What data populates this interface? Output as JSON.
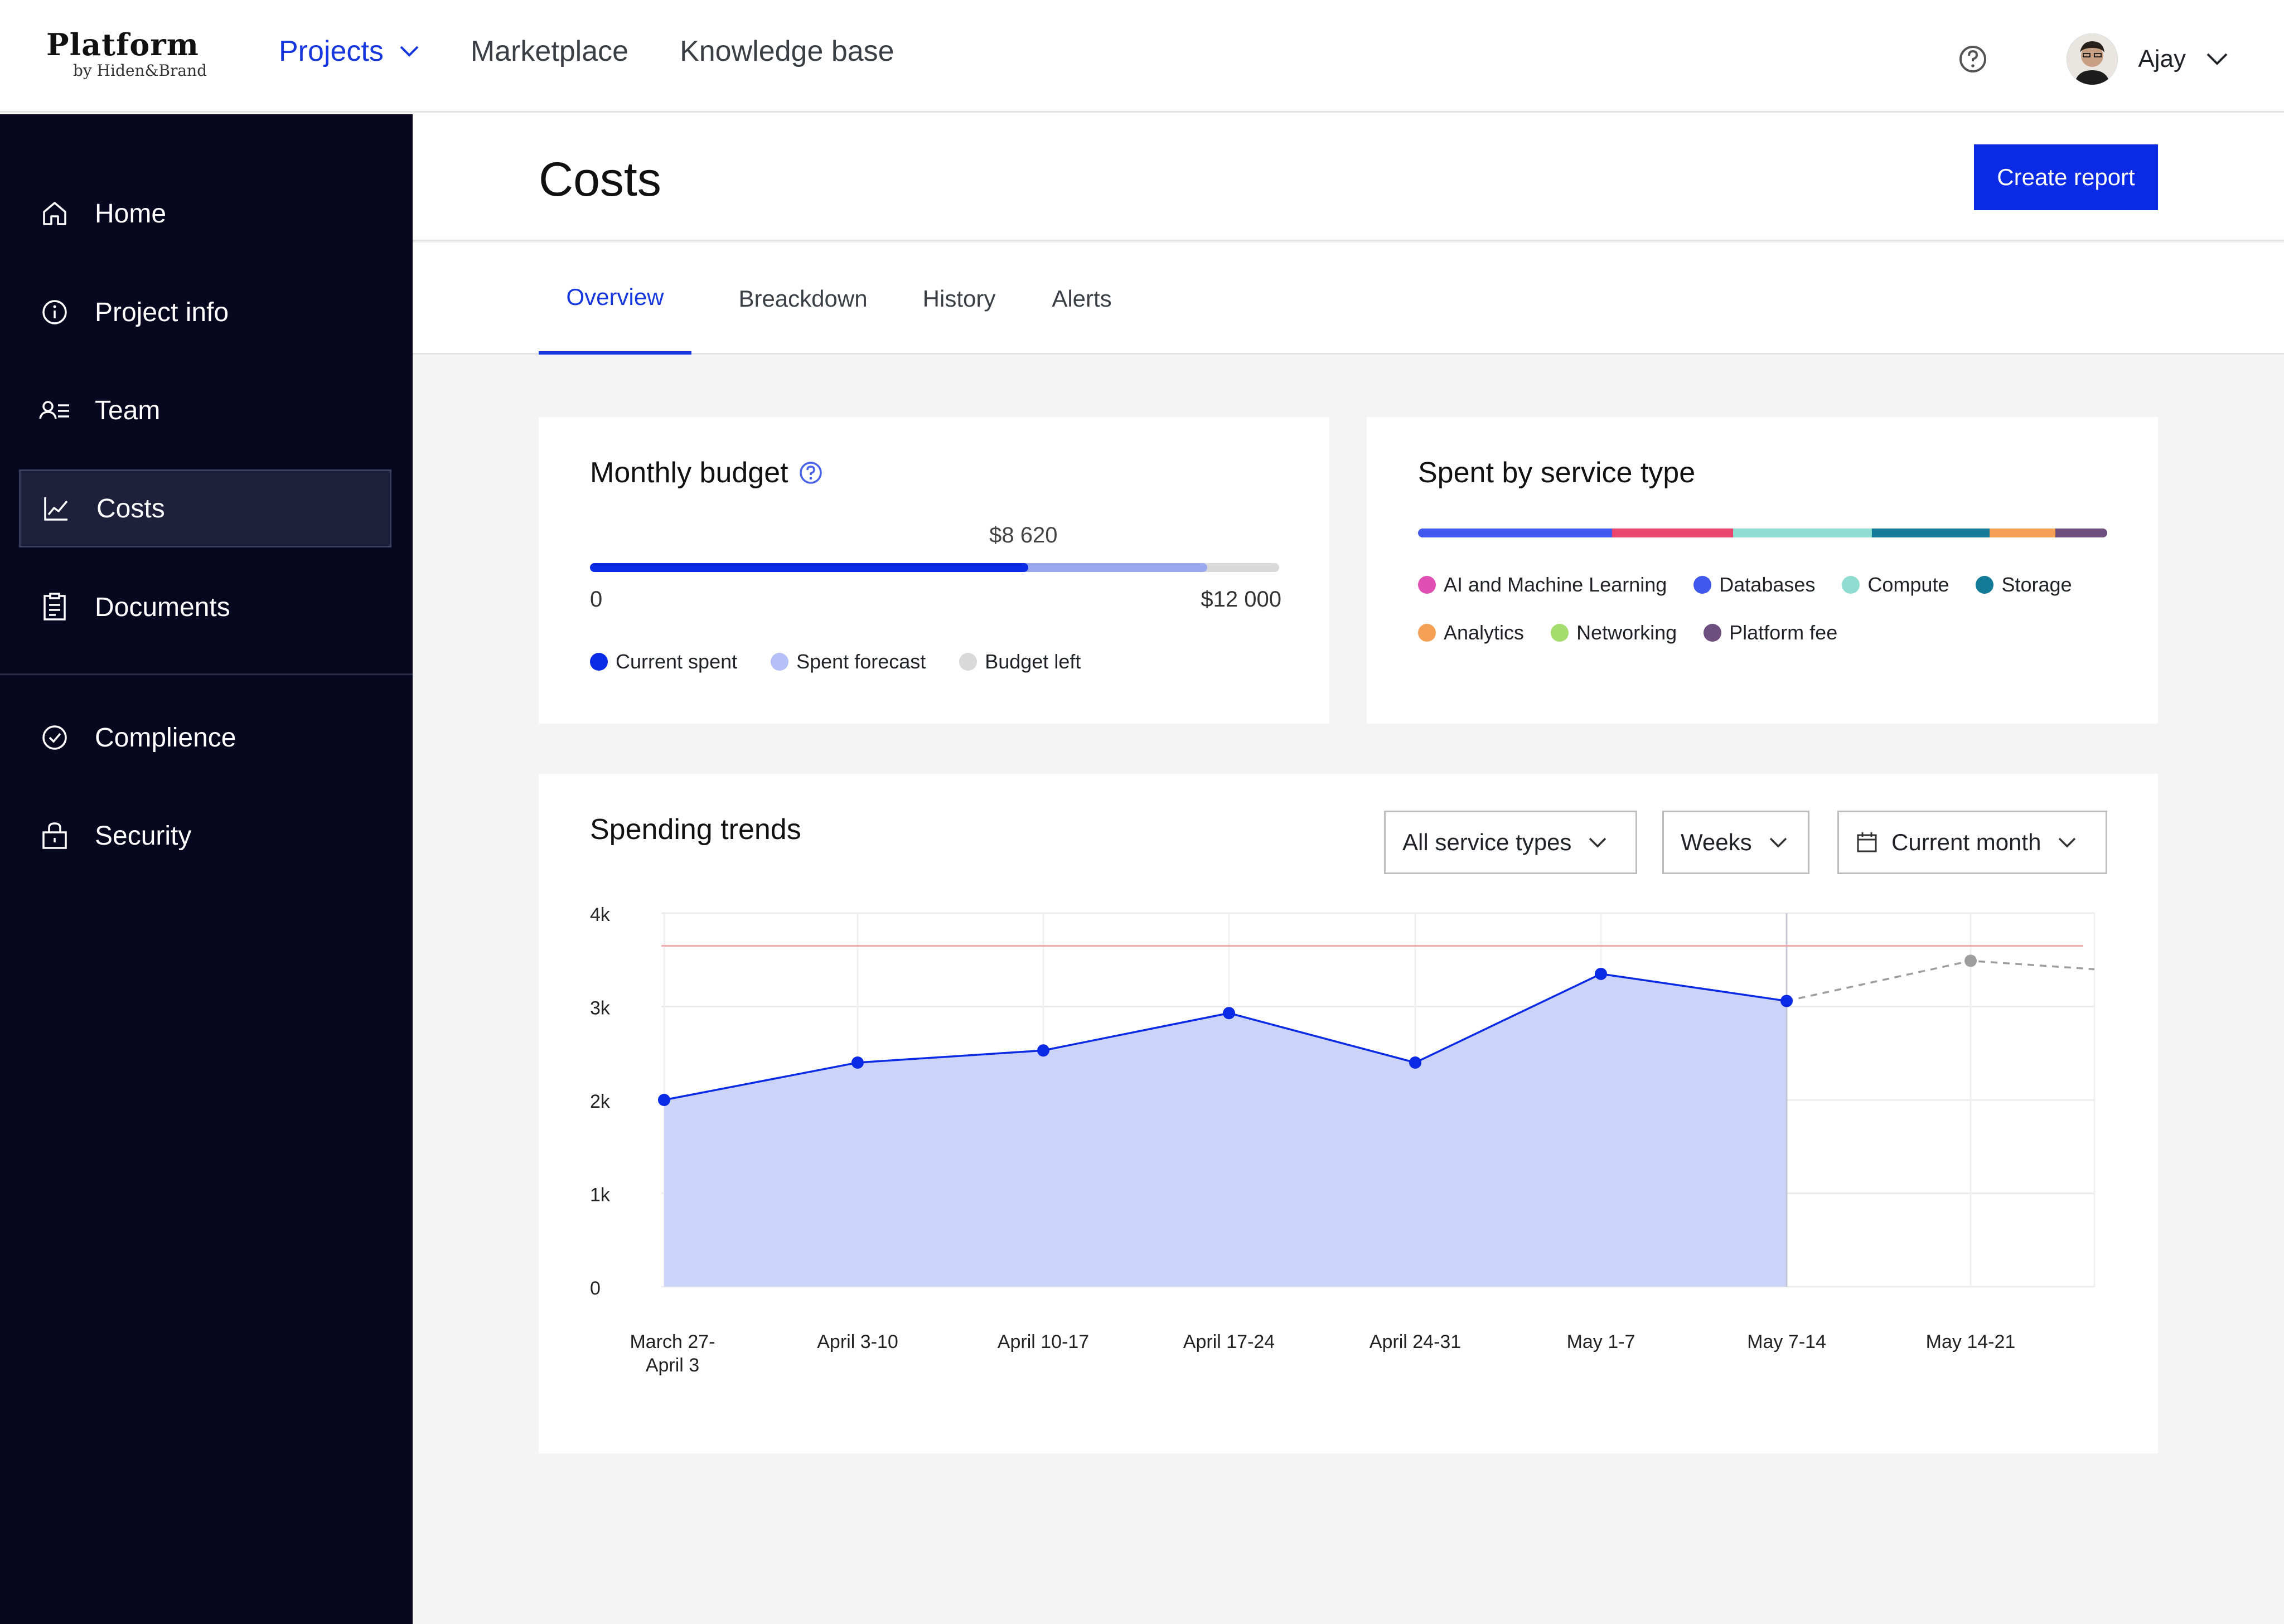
{
  "brand": {
    "name": "Platform",
    "sub": "by Hiden&Brand"
  },
  "topnav": {
    "items": [
      {
        "label": "Projects",
        "active": true
      },
      {
        "label": "Marketplace",
        "active": false
      },
      {
        "label": "Knowledge base",
        "active": false
      }
    ],
    "user": "Ajay"
  },
  "sidebar": {
    "items": [
      {
        "label": "Home",
        "icon": "home-icon"
      },
      {
        "label": "Project info",
        "icon": "info-icon"
      },
      {
        "label": "Team",
        "icon": "team-icon"
      },
      {
        "label": "Costs",
        "icon": "chart-line-icon",
        "active": true
      },
      {
        "label": "Documents",
        "icon": "clipboard-icon"
      },
      {
        "label": "Complience",
        "icon": "check-circle-icon"
      },
      {
        "label": "Security",
        "icon": "lock-icon"
      }
    ]
  },
  "page": {
    "title": "Costs",
    "create_label": "Create report"
  },
  "tabs": [
    {
      "label": "Overview",
      "active": true
    },
    {
      "label": "Breackdown"
    },
    {
      "label": "History"
    },
    {
      "label": "Alerts"
    }
  ],
  "budget": {
    "title": "Monthly budget",
    "current_label": "$8 620",
    "min_label": "0",
    "max_label": "$12 000",
    "current_fraction": 0.636,
    "forecast_fraction": 0.896,
    "legend": [
      {
        "label": "Current spent",
        "color": "#0a2ae6"
      },
      {
        "label": "Spent forecast",
        "color": "#b4c0f7"
      },
      {
        "label": "Budget left",
        "color": "#d9d9d9"
      }
    ]
  },
  "services": {
    "title": "Spent by service type",
    "items": [
      {
        "label": "AI and Machine Learning",
        "color": "#e04fb4",
        "share": 0
      },
      {
        "label": "Databases",
        "color": "#4058ec",
        "share": 0.28
      },
      {
        "label": "Compute",
        "color": "#8fdcd0",
        "share": 0.2
      },
      {
        "label": "Storage",
        "color": "#137b98",
        "share": 0.17
      },
      {
        "label": "Analytics",
        "color": "#f4a155",
        "share": 0.095
      },
      {
        "label": "Networking",
        "color": "#a4dd6e",
        "share": 0
      },
      {
        "label": "Platform fee",
        "color": "#6e4e7e",
        "share": 0.075
      }
    ],
    "bar_lead": {
      "color": "#e8446e",
      "share": 0.175
    }
  },
  "trends": {
    "title": "Spending trends",
    "filters": {
      "service": "All service types",
      "period": "Weeks",
      "range": "Current month"
    }
  },
  "chart_data": {
    "type": "area",
    "categories": [
      "March 27-\nApril 3",
      "April 3-10",
      "April 10-17",
      "April 17-24",
      "April 24-31",
      "May 1-7",
      "May 7-14",
      "May 14-21"
    ],
    "yticks": [
      "0",
      "1k",
      "2k",
      "3k",
      "4k"
    ],
    "ylim": [
      0,
      4000
    ],
    "actual": [
      2000,
      2400,
      2530,
      2930,
      2400,
      3350,
      3060
    ],
    "forecast": [
      3060,
      3490,
      3400
    ],
    "budget_line": 3650,
    "colors": {
      "actual_line": "#0a2ae6",
      "actual_fill": "#cbd3f8",
      "forecast_line": "#9e9e9e",
      "budget_line": "#f0a8a8"
    }
  }
}
